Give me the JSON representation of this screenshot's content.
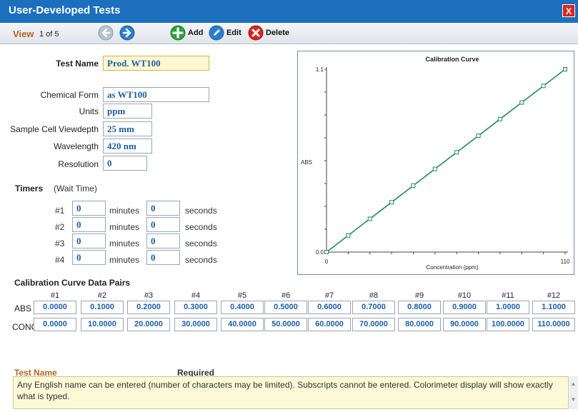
{
  "window": {
    "title": "User-Developed Tests",
    "close_label": "X"
  },
  "toolbar": {
    "view_label": "View",
    "view_count": "1 of 5",
    "add_label": "Add",
    "edit_label": "Edit",
    "delete_label": "Delete",
    "icons": {
      "prev": "arrow-left-icon",
      "next": "arrow-right-icon",
      "add": "plus-icon",
      "edit": "pencil-icon",
      "delete": "x-icon"
    }
  },
  "form": {
    "test_name_label": "Test Name",
    "test_name_value": "Prod. WT100",
    "chemical_form_label": "Chemical Form",
    "chemical_form_value": "as WT100",
    "units_label": "Units",
    "units_value": "ppm",
    "viewdepth_label": "Sample Cell Viewdepth",
    "viewdepth_value": "25 mm",
    "wavelength_label": "Wavelength",
    "wavelength_value": "420 nm",
    "resolution_label": "Resolution",
    "resolution_value": "0"
  },
  "timers": {
    "title": "Timers",
    "subtitle": "(Wait Time)",
    "minutes_label": "minutes",
    "seconds_label": "seconds",
    "rows": [
      {
        "label": "#1",
        "minutes": "0",
        "seconds": "0"
      },
      {
        "label": "#2",
        "minutes": "0",
        "seconds": "0"
      },
      {
        "label": "#3",
        "minutes": "0",
        "seconds": "0"
      },
      {
        "label": "#4",
        "minutes": "0",
        "seconds": "0"
      }
    ]
  },
  "chart_data": {
    "type": "line",
    "title": "Calibration Curve",
    "xlabel": "Concentration  (ppm)",
    "ylabel": "ABS",
    "xlim": [
      0,
      110
    ],
    "ylim": [
      0.0,
      1.1
    ],
    "x_tick_labels": [
      "0",
      "110"
    ],
    "y_tick_labels": [
      "0.0",
      "1.1"
    ],
    "x": [
      0,
      10,
      20,
      30,
      40,
      50,
      60,
      70,
      80,
      90,
      100,
      110
    ],
    "y": [
      0.0,
      0.1,
      0.2,
      0.3,
      0.4,
      0.5,
      0.6,
      0.7,
      0.8,
      0.9,
      1.0,
      1.1
    ],
    "line_color": "#1f8a5c",
    "grid": false
  },
  "data_pairs": {
    "title": "Calibration Curve Data Pairs",
    "abs_label": "ABS",
    "conc_label": "CONC",
    "headers": [
      "#1",
      "#2",
      "#3",
      "#4",
      "#5",
      "#6",
      "#7",
      "#8",
      "#9",
      "#10",
      "#11",
      "#12"
    ],
    "abs": [
      "0.0000",
      "0.1000",
      "0.2000",
      "0.3000",
      "0.4000",
      "0.5000",
      "0.6000",
      "0.7000",
      "0.8000",
      "0.9000",
      "1.0000",
      "1.1000"
    ],
    "conc": [
      "0.0000",
      "10.0000",
      "20.0000",
      "30.0000",
      "40.0000",
      "50.0000",
      "60.0000",
      "70.0000",
      "80.0000",
      "90.0000",
      "100.0000",
      "110.0000"
    ]
  },
  "help": {
    "field_name": "Test Name",
    "required_label": "Required",
    "text": "Any English name can be entered (number of characters may be limited). Subscripts cannot be entered. Colorimeter display will show exactly what is typed."
  },
  "colors": {
    "titlebar": "#1c6fbd",
    "accent": "#b5651d",
    "field_text": "#1b5ea8",
    "close": "#d9241c"
  }
}
